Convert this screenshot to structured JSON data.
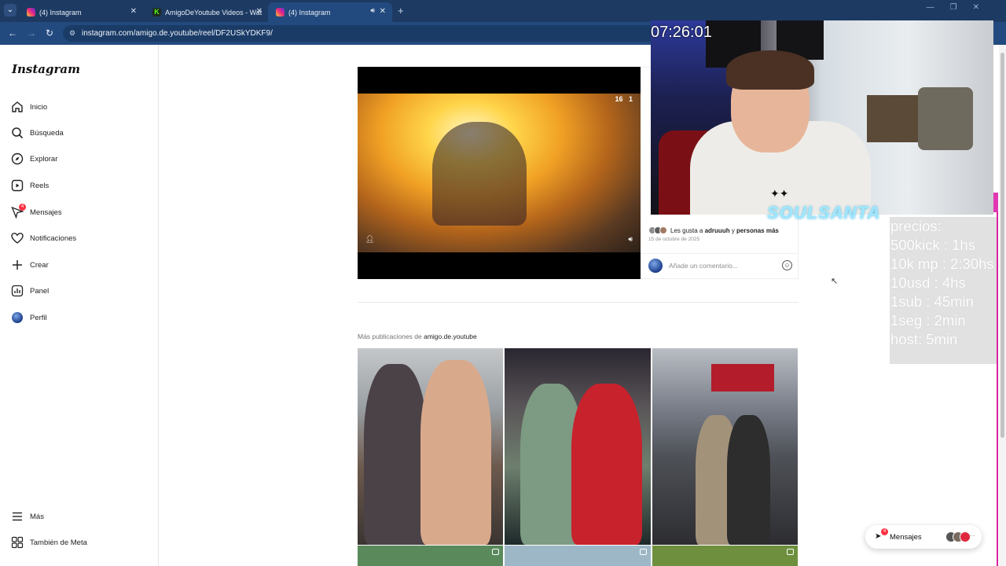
{
  "browser": {
    "tabs": [
      {
        "label": "(4) Instagram",
        "favicon": "instagram-icon",
        "active": false
      },
      {
        "label": "AmigoDeYoutube Videos - Wat",
        "favicon": "kick-icon",
        "active": false
      },
      {
        "label": "(4) Instagram",
        "favicon": "instagram-icon",
        "active": true
      }
    ],
    "url": "instagram.com/amigo.de.youtube/reel/DF2USkYDKF9/"
  },
  "sidebar": {
    "logo": "Instagram",
    "items": [
      {
        "label": "Inicio",
        "icon": "home-icon"
      },
      {
        "label": "Búsqueda",
        "icon": "search-icon"
      },
      {
        "label": "Explorar",
        "icon": "compass-icon"
      },
      {
        "label": "Reels",
        "icon": "reels-icon"
      },
      {
        "label": "Mensajes",
        "icon": "messenger-icon",
        "badge": "4"
      },
      {
        "label": "Notificaciones",
        "icon": "heart-icon"
      },
      {
        "label": "Crear",
        "icon": "plus-icon"
      },
      {
        "label": "Panel",
        "icon": "chart-icon"
      },
      {
        "label": "Perfil",
        "icon": "avatar"
      }
    ],
    "bottom": [
      {
        "label": "Más",
        "icon": "menu-icon"
      },
      {
        "label": "También de Meta",
        "icon": "meta-apps-icon"
      }
    ]
  },
  "post": {
    "video_hud": "16",
    "video_hud2": "1",
    "likes_prefix": "Les gusta a ",
    "likes_user": "adruuuh",
    "likes_mid": " y ",
    "likes_rest": "personas más",
    "date": "15 de octubre de 2025",
    "comment_placeholder": "Añade un comentario..."
  },
  "more_posts": {
    "prefix": "Más publicaciones de ",
    "account": "amigo.de.youtube"
  },
  "messages_pill": {
    "label": "Mensajes",
    "badge": "4"
  },
  "overlay": {
    "clock": "07:26:01",
    "watermark": "SOULSANTA",
    "prices": [
      "precios:",
      "500kick : 1hs",
      "10k mp : 2:30hs",
      "10usd : 4hs",
      "1sub : 45min",
      "1seg : 2min",
      "host: 5min"
    ]
  },
  "colors": {
    "tabbar": "#1d3a63",
    "addressbar": "#234a7e",
    "notification_red": "#ff3040",
    "stream_pink": "#d8239f"
  }
}
